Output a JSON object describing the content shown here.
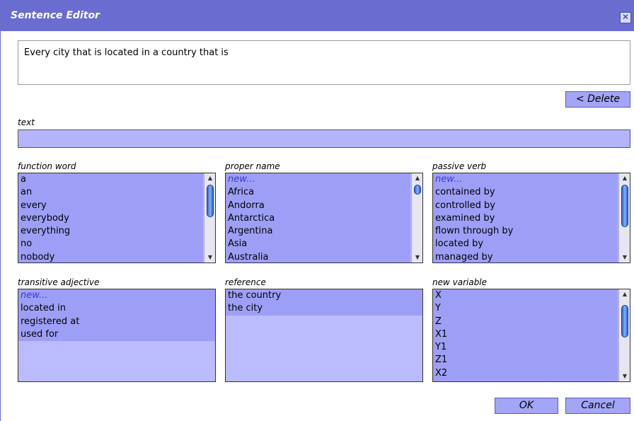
{
  "window": {
    "title": "Sentence Editor",
    "close_glyph": "✕"
  },
  "sentence": {
    "text": "Every city that is located in a country that is"
  },
  "toolbar": {
    "delete_label": "< Delete"
  },
  "text_field": {
    "label": "text",
    "value": ""
  },
  "lists": {
    "function_word": {
      "label": "function word",
      "items": [
        "a",
        "an",
        "every",
        "everybody",
        "everything",
        "no",
        "nobody"
      ]
    },
    "proper_name": {
      "label": "proper name",
      "items": [
        "new...",
        "Africa",
        "Andorra",
        "Antarctica",
        "Argentina",
        "Asia",
        "Australia"
      ]
    },
    "passive_verb": {
      "label": "passive verb",
      "items": [
        "new...",
        "contained by",
        "controlled by",
        "examined by",
        "flown through by",
        "located by",
        "managed by"
      ]
    },
    "transitive_adjective": {
      "label": "transitive adjective",
      "items": [
        "new...",
        "located in",
        "registered at",
        "used for"
      ]
    },
    "reference": {
      "label": "reference",
      "items": [
        "the country",
        "the city"
      ]
    },
    "new_variable": {
      "label": "new variable",
      "items": [
        "X",
        "Y",
        "Z",
        "X1",
        "Y1",
        "Z1",
        "X2"
      ]
    }
  },
  "footer": {
    "ok_label": "OK",
    "cancel_label": "Cancel"
  },
  "icons": {
    "close": "close-icon",
    "scroll_up": "scroll-up-icon",
    "scroll_down": "scroll-down-icon"
  },
  "colors": {
    "titlebar": "#6b6ccf",
    "list_fill": "#9d9ff7",
    "list_bg": "#bbbbff",
    "button": "#a3a5f6",
    "new_item": "#3a37d6"
  }
}
